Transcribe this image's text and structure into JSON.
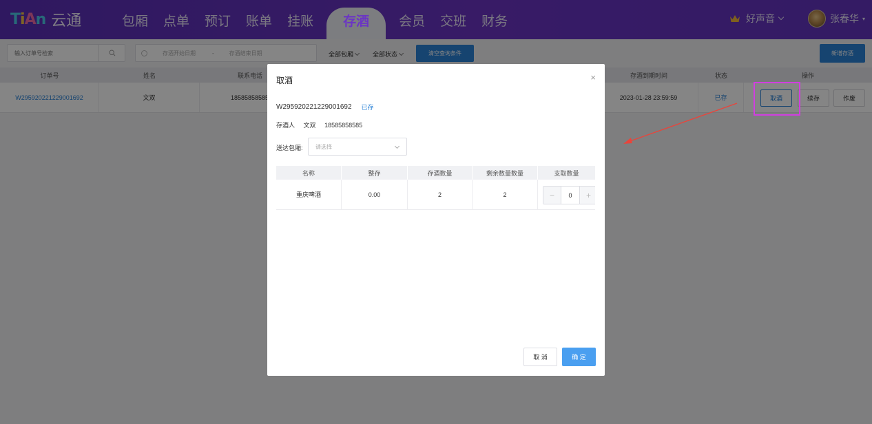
{
  "header": {
    "logo_mark": "TiAn",
    "logo_text": "云通",
    "nav": [
      {
        "label": "包厢"
      },
      {
        "label": "点单"
      },
      {
        "label": "预订"
      },
      {
        "label": "账单"
      },
      {
        "label": "挂账"
      },
      {
        "label": "存酒",
        "active": true
      },
      {
        "label": "会员"
      },
      {
        "label": "交班"
      },
      {
        "label": "财务"
      }
    ],
    "store_name": "好声音",
    "user_name": "张春华"
  },
  "toolbar": {
    "search_placeholder": "输入订单号检索",
    "date_start_placeholder": "存酒开始日期",
    "date_separator": "-",
    "date_end_placeholder": "存酒结束日期",
    "room_filter": "全部包厢",
    "status_filter": "全部状态",
    "clear_button": "清空查询条件",
    "new_button": "新增存酒"
  },
  "table": {
    "columns": [
      "订单号",
      "姓名",
      "联系电话",
      "存酒到期时间",
      "状态",
      "操作"
    ],
    "rows": [
      {
        "order_no": "W295920221229001692",
        "name": "文双",
        "phone": "18585858585",
        "expire": "2023-01-28 23:59:59",
        "status": "已存",
        "actions": [
          "取酒",
          "续存",
          "作废"
        ]
      }
    ]
  },
  "modal": {
    "title": "取酒",
    "close": "×",
    "order_no": "W295920221229001692",
    "order_status": "已存",
    "depositor_label": "存酒人",
    "depositor_name": "文双",
    "depositor_phone": "18585858585",
    "room_label": "送达包厢:",
    "room_placeholder": "请选择",
    "columns": [
      "名称",
      "整存",
      "存酒数量",
      "剩余数量数量",
      "支取数量"
    ],
    "items": [
      {
        "name": "重庆啤酒",
        "whole": "0.00",
        "qty": "2",
        "remain": "2",
        "take": "0"
      }
    ],
    "stepper_minus": "−",
    "stepper_plus": "+",
    "cancel_button": "取 消",
    "ok_button": "确 定"
  },
  "colors": {
    "header_purple": "#6434c0",
    "primary_blue": "#2b82d6",
    "highlight_magenta": "#d13ee0",
    "arrow_red": "#e8453c"
  }
}
